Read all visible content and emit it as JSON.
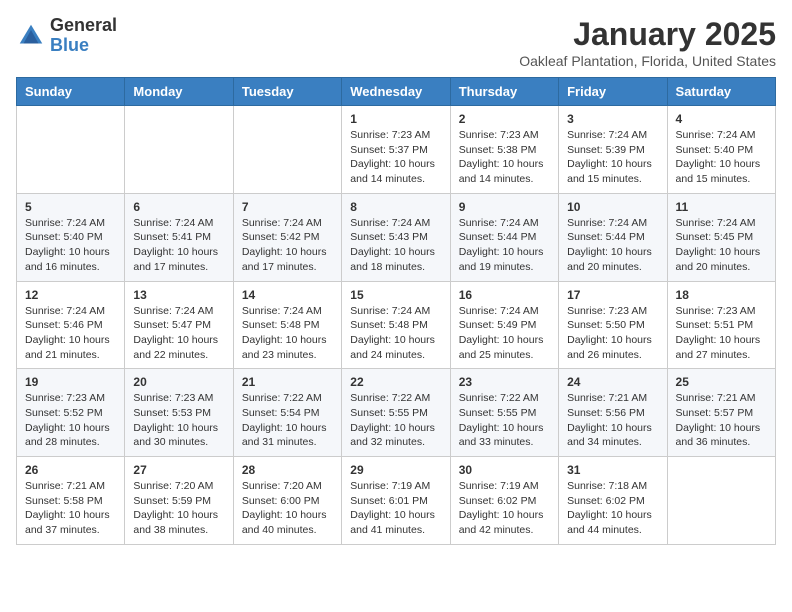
{
  "header": {
    "logo_general": "General",
    "logo_blue": "Blue",
    "month_year": "January 2025",
    "location": "Oakleaf Plantation, Florida, United States"
  },
  "weekdays": [
    "Sunday",
    "Monday",
    "Tuesday",
    "Wednesday",
    "Thursday",
    "Friday",
    "Saturday"
  ],
  "weeks": [
    [
      {
        "day": "",
        "info": ""
      },
      {
        "day": "",
        "info": ""
      },
      {
        "day": "",
        "info": ""
      },
      {
        "day": "1",
        "info": "Sunrise: 7:23 AM\nSunset: 5:37 PM\nDaylight: 10 hours\nand 14 minutes."
      },
      {
        "day": "2",
        "info": "Sunrise: 7:23 AM\nSunset: 5:38 PM\nDaylight: 10 hours\nand 14 minutes."
      },
      {
        "day": "3",
        "info": "Sunrise: 7:24 AM\nSunset: 5:39 PM\nDaylight: 10 hours\nand 15 minutes."
      },
      {
        "day": "4",
        "info": "Sunrise: 7:24 AM\nSunset: 5:40 PM\nDaylight: 10 hours\nand 15 minutes."
      }
    ],
    [
      {
        "day": "5",
        "info": "Sunrise: 7:24 AM\nSunset: 5:40 PM\nDaylight: 10 hours\nand 16 minutes."
      },
      {
        "day": "6",
        "info": "Sunrise: 7:24 AM\nSunset: 5:41 PM\nDaylight: 10 hours\nand 17 minutes."
      },
      {
        "day": "7",
        "info": "Sunrise: 7:24 AM\nSunset: 5:42 PM\nDaylight: 10 hours\nand 17 minutes."
      },
      {
        "day": "8",
        "info": "Sunrise: 7:24 AM\nSunset: 5:43 PM\nDaylight: 10 hours\nand 18 minutes."
      },
      {
        "day": "9",
        "info": "Sunrise: 7:24 AM\nSunset: 5:44 PM\nDaylight: 10 hours\nand 19 minutes."
      },
      {
        "day": "10",
        "info": "Sunrise: 7:24 AM\nSunset: 5:44 PM\nDaylight: 10 hours\nand 20 minutes."
      },
      {
        "day": "11",
        "info": "Sunrise: 7:24 AM\nSunset: 5:45 PM\nDaylight: 10 hours\nand 20 minutes."
      }
    ],
    [
      {
        "day": "12",
        "info": "Sunrise: 7:24 AM\nSunset: 5:46 PM\nDaylight: 10 hours\nand 21 minutes."
      },
      {
        "day": "13",
        "info": "Sunrise: 7:24 AM\nSunset: 5:47 PM\nDaylight: 10 hours\nand 22 minutes."
      },
      {
        "day": "14",
        "info": "Sunrise: 7:24 AM\nSunset: 5:48 PM\nDaylight: 10 hours\nand 23 minutes."
      },
      {
        "day": "15",
        "info": "Sunrise: 7:24 AM\nSunset: 5:48 PM\nDaylight: 10 hours\nand 24 minutes."
      },
      {
        "day": "16",
        "info": "Sunrise: 7:24 AM\nSunset: 5:49 PM\nDaylight: 10 hours\nand 25 minutes."
      },
      {
        "day": "17",
        "info": "Sunrise: 7:23 AM\nSunset: 5:50 PM\nDaylight: 10 hours\nand 26 minutes."
      },
      {
        "day": "18",
        "info": "Sunrise: 7:23 AM\nSunset: 5:51 PM\nDaylight: 10 hours\nand 27 minutes."
      }
    ],
    [
      {
        "day": "19",
        "info": "Sunrise: 7:23 AM\nSunset: 5:52 PM\nDaylight: 10 hours\nand 28 minutes."
      },
      {
        "day": "20",
        "info": "Sunrise: 7:23 AM\nSunset: 5:53 PM\nDaylight: 10 hours\nand 30 minutes."
      },
      {
        "day": "21",
        "info": "Sunrise: 7:22 AM\nSunset: 5:54 PM\nDaylight: 10 hours\nand 31 minutes."
      },
      {
        "day": "22",
        "info": "Sunrise: 7:22 AM\nSunset: 5:55 PM\nDaylight: 10 hours\nand 32 minutes."
      },
      {
        "day": "23",
        "info": "Sunrise: 7:22 AM\nSunset: 5:55 PM\nDaylight: 10 hours\nand 33 minutes."
      },
      {
        "day": "24",
        "info": "Sunrise: 7:21 AM\nSunset: 5:56 PM\nDaylight: 10 hours\nand 34 minutes."
      },
      {
        "day": "25",
        "info": "Sunrise: 7:21 AM\nSunset: 5:57 PM\nDaylight: 10 hours\nand 36 minutes."
      }
    ],
    [
      {
        "day": "26",
        "info": "Sunrise: 7:21 AM\nSunset: 5:58 PM\nDaylight: 10 hours\nand 37 minutes."
      },
      {
        "day": "27",
        "info": "Sunrise: 7:20 AM\nSunset: 5:59 PM\nDaylight: 10 hours\nand 38 minutes."
      },
      {
        "day": "28",
        "info": "Sunrise: 7:20 AM\nSunset: 6:00 PM\nDaylight: 10 hours\nand 40 minutes."
      },
      {
        "day": "29",
        "info": "Sunrise: 7:19 AM\nSunset: 6:01 PM\nDaylight: 10 hours\nand 41 minutes."
      },
      {
        "day": "30",
        "info": "Sunrise: 7:19 AM\nSunset: 6:02 PM\nDaylight: 10 hours\nand 42 minutes."
      },
      {
        "day": "31",
        "info": "Sunrise: 7:18 AM\nSunset: 6:02 PM\nDaylight: 10 hours\nand 44 minutes."
      },
      {
        "day": "",
        "info": ""
      }
    ]
  ]
}
